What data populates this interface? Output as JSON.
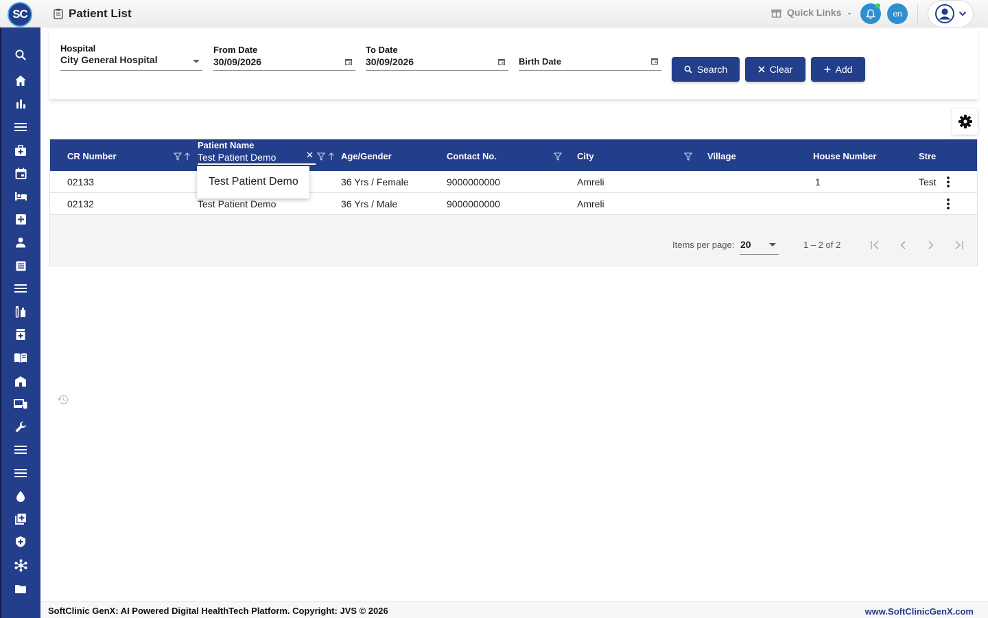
{
  "app": {
    "logo_text": "SC",
    "page_title": "Patient List",
    "brand_color": "#233e8b",
    "accent_color": "#2e8fd0"
  },
  "header": {
    "quick_links_label": "Quick Links",
    "language_label": "en"
  },
  "filters": {
    "hospital": {
      "label": "Hospital",
      "value": "City General Hospital"
    },
    "from_date": {
      "label": "From Date",
      "value": "30/09/2026"
    },
    "to_date": {
      "label": "To Date",
      "value": "30/09/2026"
    },
    "birth_date": {
      "label": "Birth Date",
      "value": ""
    }
  },
  "buttons": {
    "search": "Search",
    "clear": "Clear",
    "add": "Add"
  },
  "table": {
    "headers": {
      "cr_number": "CR Number",
      "patient_name": "Patient Name",
      "age_gender": "Age/Gender",
      "contact": "Contact No.",
      "city": "City",
      "village": "Village",
      "house_number": "House Number",
      "street": "Stre"
    },
    "name_filter_value": "Test Patient Demo",
    "rows": [
      {
        "cr_number": "02133",
        "patient_name": "",
        "age_gender": "36 Yrs / Female",
        "contact": "9000000000",
        "city": "Amreli",
        "village": "",
        "house_number": "1",
        "street": "Test"
      },
      {
        "cr_number": "02132",
        "patient_name": "Test Patient Demo",
        "age_gender": "36 Yrs / Male",
        "contact": "9000000000",
        "city": "Amreli",
        "village": "",
        "house_number": "",
        "street": ""
      }
    ]
  },
  "autocomplete": {
    "option": "Test Patient Demo"
  },
  "paginator": {
    "items_per_page_label": "Items per page:",
    "items_per_page": "20",
    "range": "1 – 2 of 2"
  },
  "footer": {
    "copyright": "SoftClinic GenX: AI Powered Digital HealthTech Platform. Copyright: JVS © 2026",
    "website": "www.SoftClinicGenX.com"
  },
  "sidebar_icons": [
    "search-icon",
    "home-icon",
    "bar-chart-icon",
    "menu-icon",
    "medical-bag-icon",
    "calendar-icon",
    "bed-icon",
    "plus-box-icon",
    "person-icon",
    "document-icon",
    "menu-icon",
    "lab-icon",
    "pharmacy-icon",
    "book-icon",
    "building-icon",
    "devices-icon",
    "wrench-icon",
    "menu-icon",
    "menu-icon",
    "blood-drop-icon",
    "add-library-icon",
    "shield-icon",
    "hub-icon",
    "folder-icon"
  ]
}
